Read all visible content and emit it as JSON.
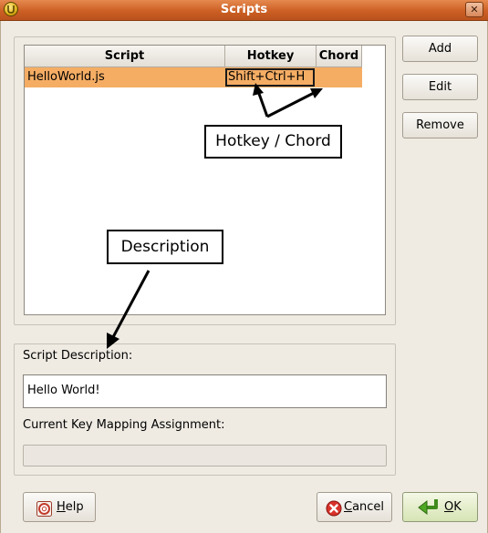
{
  "window": {
    "title": "Scripts",
    "close_glyph": "✕"
  },
  "table": {
    "columns": [
      "Script",
      "Hotkey",
      "Chord"
    ],
    "rows": [
      {
        "script": "HelloWorld.js",
        "hotkey": "Shift+Ctrl+H",
        "chord": ""
      }
    ],
    "selected_row_color": "#f5ad64"
  },
  "side_buttons": {
    "add": "Add",
    "edit": "Edit",
    "remove": "Remove"
  },
  "callouts": {
    "hotkey_chord": "Hotkey / Chord",
    "description": "Description"
  },
  "description_section": {
    "script_description_label": "Script Description:",
    "script_description_value": "Hello World!",
    "key_mapping_label": "Current Key Mapping Assignment:",
    "key_mapping_value": ""
  },
  "footer": {
    "help_first": "H",
    "help_rest": "elp",
    "cancel_first": "C",
    "cancel_rest": "ancel",
    "ok_first": "O",
    "ok_rest": "K"
  },
  "icons": {
    "app": "app-logo-icon",
    "help": "help-lifebuoy-icon",
    "cancel": "cancel-x-icon",
    "ok": "ok-return-arrow-icon"
  }
}
